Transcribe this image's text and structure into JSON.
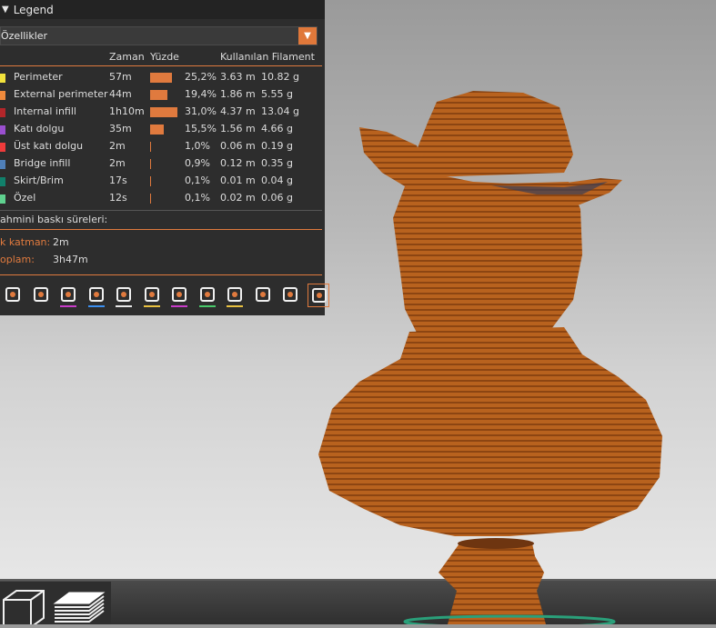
{
  "legend": {
    "title": "Legend",
    "dropdown_value": "Özellikler",
    "headers": {
      "time": "Zaman",
      "percent": "Yüzde",
      "filament": "Kullanılan Filament"
    },
    "rows": [
      {
        "name": "Perimeter",
        "time": "57m",
        "percent": "25,2%",
        "length": "3.63 m",
        "weight": "10.82 g",
        "color": "#f2e23c",
        "pct": 25.2
      },
      {
        "name": "External perimeter",
        "time": "44m",
        "percent": "19,4%",
        "length": "1.86 m",
        "weight": "5.55 g",
        "color": "#f08a3c",
        "pct": 19.4
      },
      {
        "name": "Internal infill",
        "time": "1h10m",
        "percent": "31,0%",
        "length": "4.37 m",
        "weight": "13.04 g",
        "color": "#b3262a",
        "pct": 31.0
      },
      {
        "name": "Katı dolgu",
        "time": "35m",
        "percent": "15,5%",
        "length": "1.56 m",
        "weight": "4.66 g",
        "color": "#9a4fcf",
        "pct": 15.5
      },
      {
        "name": "Üst katı dolgu",
        "time": "2m",
        "percent": "1,0%",
        "length": "0.06 m",
        "weight": "0.19 g",
        "color": "#ef3b3b",
        "pct": 1.0
      },
      {
        "name": "Bridge infill",
        "time": "2m",
        "percent": "0,9%",
        "length": "0.12 m",
        "weight": "0.35 g",
        "color": "#4f7fb8",
        "pct": 0.9
      },
      {
        "name": "Skirt/Brim",
        "time": "17s",
        "percent": "0,1%",
        "length": "0.01 m",
        "weight": "0.04 g",
        "color": "#11806b",
        "pct": 0.1
      },
      {
        "name": "Özel",
        "time": "12s",
        "percent": "0,1%",
        "length": "0.02 m",
        "weight": "0.06 g",
        "color": "#5fd18f",
        "pct": 0.1
      }
    ],
    "estimated_label": "ahmini baskı süreleri:",
    "first_layer_key": "k katman:",
    "first_layer_value": "2m",
    "total_key": "oplam:",
    "total_value": "3h47m"
  },
  "toolbar": [
    {
      "icon": "travel-icon",
      "underline": ""
    },
    {
      "icon": "wipe-icon",
      "underline": ""
    },
    {
      "icon": "retractions-icon",
      "underline": "#c83cc8"
    },
    {
      "icon": "deretractions-icon",
      "underline": "#3c8ff0"
    },
    {
      "icon": "seams-icon",
      "underline": "#e8e8e8"
    },
    {
      "icon": "tool-changes-icon",
      "underline": "#e8c040"
    },
    {
      "icon": "color-changes-icon",
      "underline": "#c83cc8"
    },
    {
      "icon": "pause-prints-icon",
      "underline": "#49c86a"
    },
    {
      "icon": "custom-gcodes-icon",
      "underline": "#e8c040"
    },
    {
      "icon": "center-of-gravity-icon",
      "underline": ""
    },
    {
      "icon": "shells-icon",
      "underline": ""
    },
    {
      "icon": "tool-marker-icon",
      "underline": "",
      "active": true
    }
  ],
  "colors": {
    "accent": "#e07a3e",
    "panel_bg": "#2d2d2d",
    "model": "#b8621e"
  }
}
